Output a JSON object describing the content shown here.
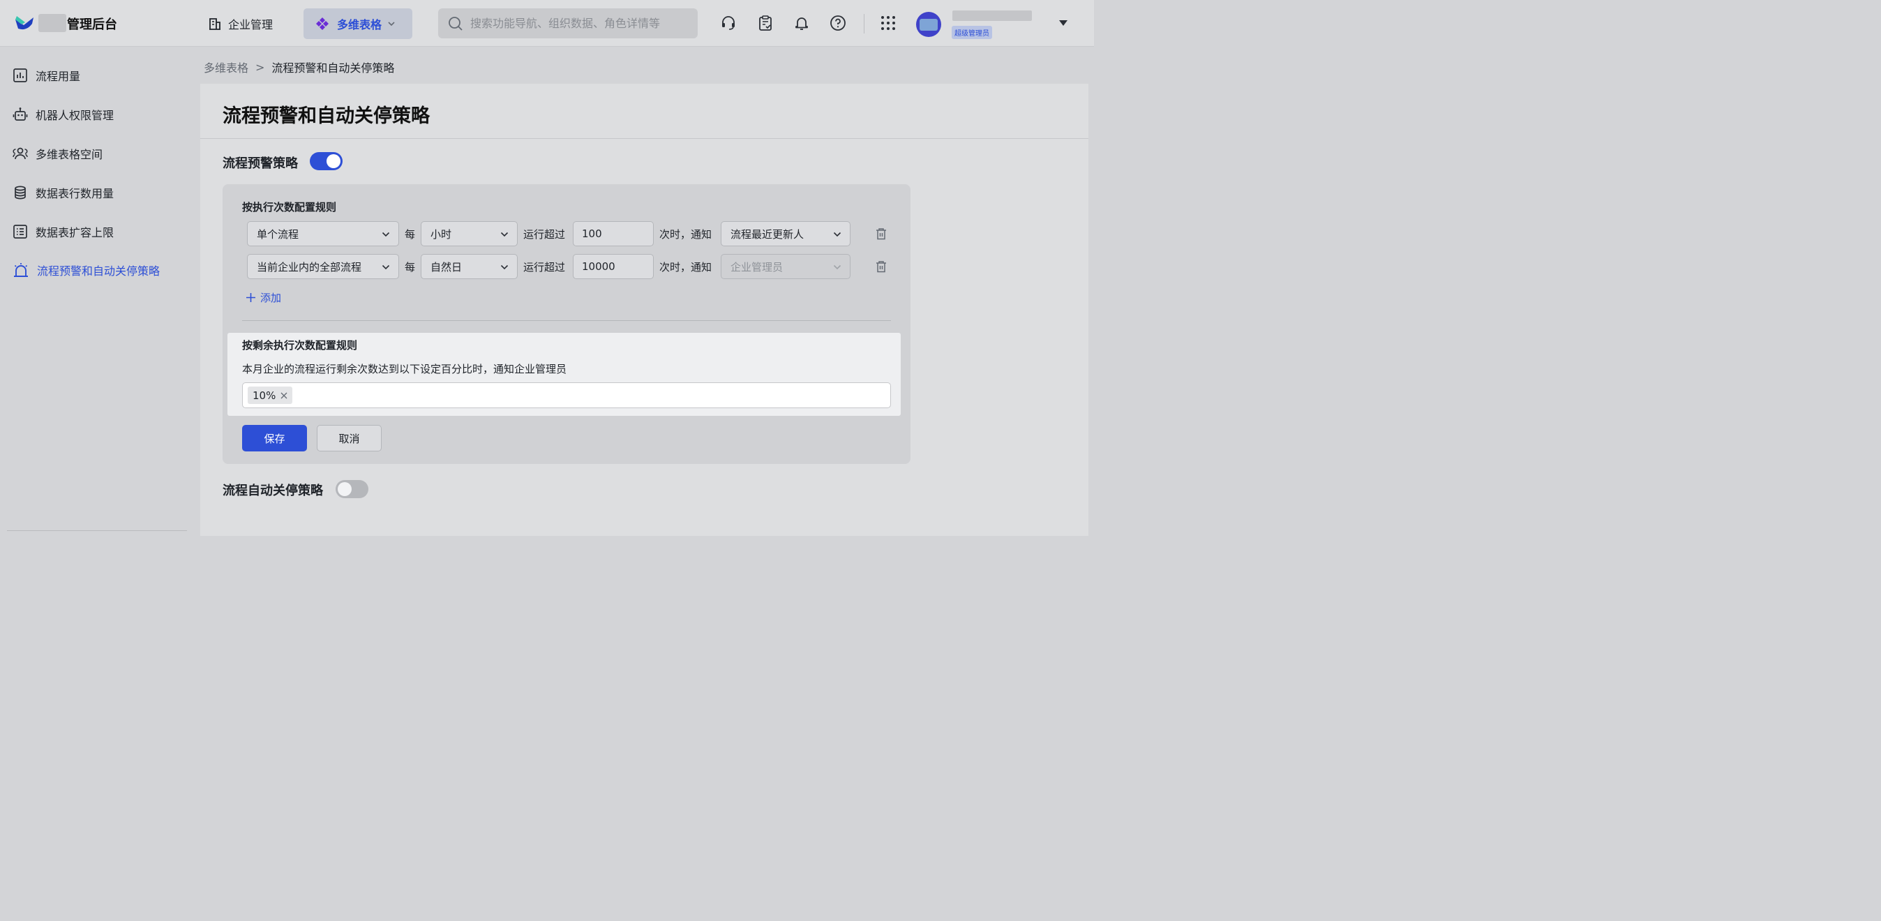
{
  "header": {
    "app_title": "管理后台",
    "nav_enterprise": "企业管理",
    "nav_bitable": "多维表格",
    "search_placeholder": "搜索功能导航、组织数据、角色详情等",
    "user_role": "超级管理员"
  },
  "sidebar": {
    "items": [
      {
        "label": "流程用量",
        "icon": "bar-chart-icon"
      },
      {
        "label": "机器人权限管理",
        "icon": "robot-icon"
      },
      {
        "label": "多维表格空间",
        "icon": "users-icon"
      },
      {
        "label": "数据表行数用量",
        "icon": "database-icon"
      },
      {
        "label": "数据表扩容上限",
        "icon": "list-icon"
      },
      {
        "label": "流程预警和自动关停策略",
        "icon": "alarm-icon",
        "active": true
      }
    ]
  },
  "breadcrumb": {
    "parent": "多维表格",
    "separator": ">",
    "current": "流程预警和自动关停策略"
  },
  "page": {
    "title": "流程预警和自动关停策略",
    "warning_section": {
      "label": "流程预警策略",
      "enabled": true,
      "by_count_title": "按执行次数配置规则",
      "rules": [
        {
          "scope": "单个流程",
          "per": "每",
          "period": "小时",
          "exceed": "运行超过",
          "count": "100",
          "times_notify": "次时，通知",
          "notify": "流程最近更新人",
          "notify_disabled": false
        },
        {
          "scope": "当前企业内的全部流程",
          "per": "每",
          "period": "自然日",
          "exceed": "运行超过",
          "count": "10000",
          "times_notify": "次时，通知",
          "notify": "企业管理员",
          "notify_disabled": true
        }
      ],
      "add_label": "添加",
      "by_remaining_title": "按剩余执行次数配置规则",
      "by_remaining_desc": "本月企业的流程运行剩余次数达到以下设定百分比时，通知企业管理员",
      "percent_tags": [
        "10%"
      ],
      "save_label": "保存",
      "cancel_label": "取消"
    },
    "shutdown_section": {
      "label": "流程自动关停策略",
      "enabled": false
    }
  },
  "colors": {
    "accent": "#2d4fd6",
    "toggle_off": "#b5b7bb"
  }
}
